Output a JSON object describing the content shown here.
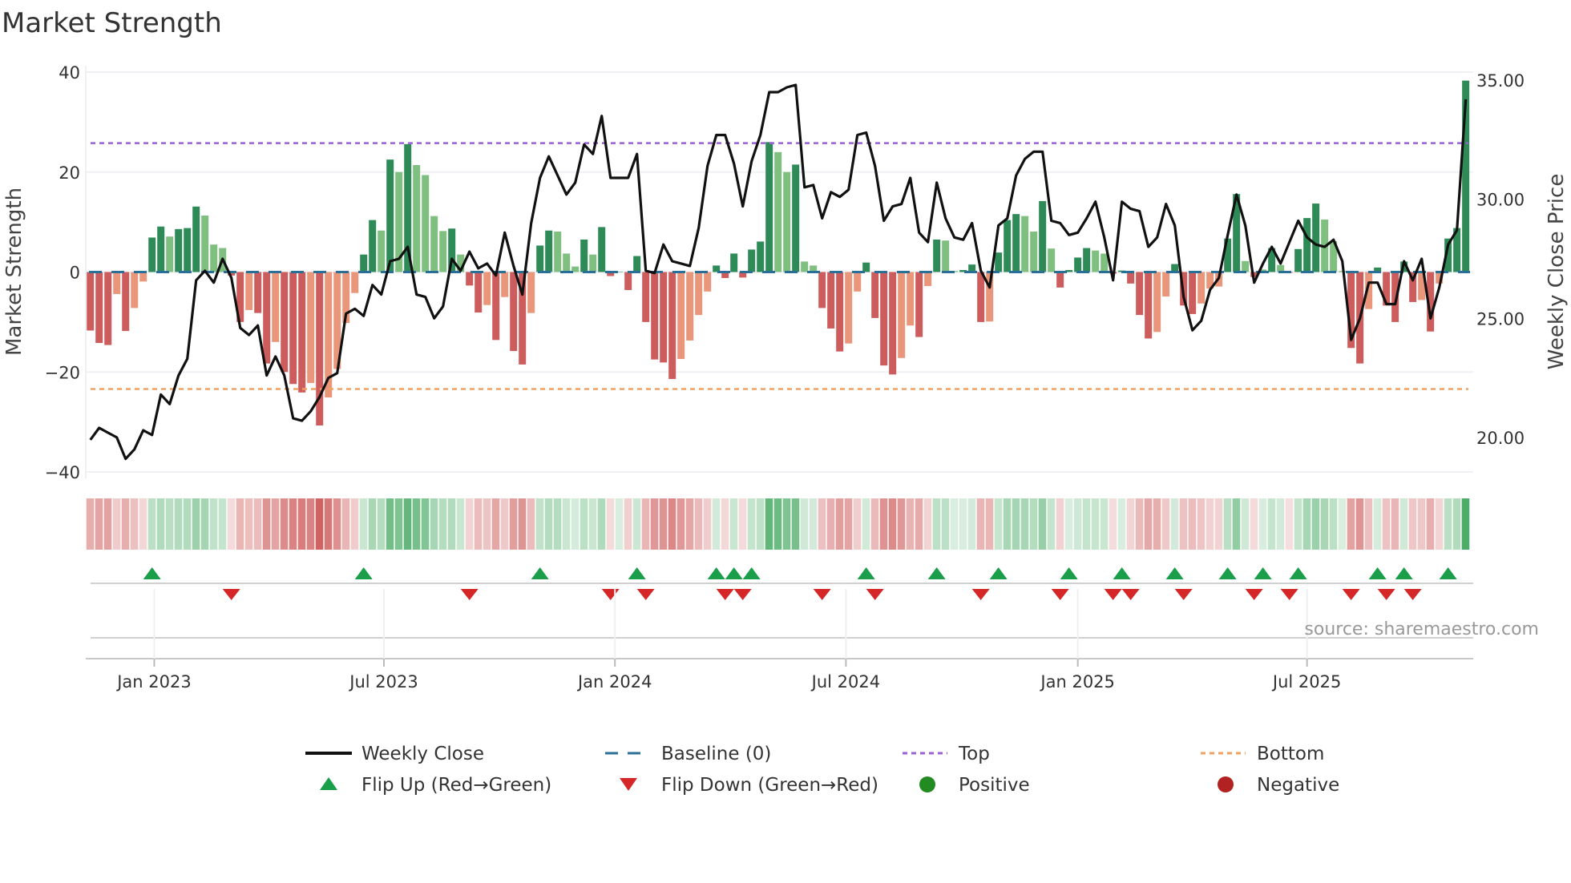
{
  "title": "Market Strength",
  "source": "source: sharemaestro.com",
  "chart_data": {
    "type": "bar+line",
    "title": "Market Strength",
    "ylabel_left": "Market Strength",
    "ylabel_right": "Weekly Close Price",
    "ylim_left": [
      -40,
      40
    ],
    "yticks_left": [
      {
        "value": 40,
        "label": "40"
      },
      {
        "value": 20,
        "label": "20"
      },
      {
        "value": 0,
        "label": "0"
      },
      {
        "value": -20,
        "label": "−20"
      },
      {
        "value": -40,
        "label": "−40"
      }
    ],
    "ylim_right": [
      18.55,
      35.34
    ],
    "yticks_right": [
      {
        "value": 35,
        "label": "35.00"
      },
      {
        "value": 30,
        "label": "30.00"
      },
      {
        "value": 25,
        "label": "25.00"
      },
      {
        "value": 20,
        "label": "20.00"
      }
    ],
    "xlim_week": [
      -0.52,
      156.85
    ],
    "x_ticks": [
      {
        "label": "Jan 2023",
        "week": 7.25
      },
      {
        "label": "Jul 2023",
        "week": 33.3
      },
      {
        "label": "Jan 2024",
        "week": 59.5
      },
      {
        "label": "Jul 2024",
        "week": 85.7
      },
      {
        "label": "Jan 2025",
        "week": 112.0
      },
      {
        "label": "Jul 2025",
        "week": 138.0
      }
    ],
    "top_level": 25.8,
    "bottom_level": -23.4,
    "grid": true,
    "strength": [
      -11.7,
      -14.2,
      -14.6,
      -4.4,
      -11.8,
      -7.2,
      -1.9,
      6.9,
      9.1,
      7.1,
      8.6,
      8.8,
      13.1,
      11.3,
      5.5,
      4.8,
      -0.7,
      -10,
      -7.6,
      -8.2,
      -18.3,
      -14,
      -20,
      -22.4,
      -24.1,
      -22.2,
      -30.7,
      -25.1,
      -19.4,
      -10.2,
      -4.2,
      3.5,
      10.4,
      8.3,
      22.5,
      20,
      25.6,
      21.4,
      19.4,
      11.2,
      8.2,
      8.7,
      3.5,
      -2.7,
      -8.1,
      -6.6,
      -13.6,
      -5,
      -15.8,
      -18.5,
      -8.2,
      5.3,
      8.3,
      8.1,
      3.7,
      1.1,
      6.5,
      3.5,
      9,
      -0.8,
      0,
      -3.6,
      3.2,
      -10,
      -17.5,
      -18.1,
      -21.4,
      -17.4,
      -13.7,
      -8.6,
      -3.9,
      1.3,
      -1.2,
      3.7,
      -1.1,
      4.5,
      6.1,
      26,
      24,
      20,
      21.5,
      2.1,
      1.3,
      -7.2,
      -11.3,
      -15.9,
      -14.3,
      -3.9,
      1.9,
      -9.2,
      -18.7,
      -20.5,
      -17.2,
      -10.7,
      -13,
      -2.8,
      6.5,
      6.3,
      0.2,
      0.4,
      1.5,
      -10,
      -9.9,
      3.9,
      10.4,
      11.6,
      11.2,
      8.1,
      14.2,
      4.7,
      -3.1,
      0.4,
      2.9,
      4.8,
      4.3,
      3.7,
      -0.3,
      0.3,
      -2.3,
      -8.6,
      -13.3,
      -12,
      -4.9,
      1.6,
      -6.7,
      -8.4,
      -6.3,
      -3.3,
      -2.9,
      6.7,
      15.6,
      2.2,
      -1,
      0.5,
      4.8,
      1.4,
      -0.2,
      4.6,
      10.8,
      13.7,
      10.5,
      6.2,
      0.2,
      -15.2,
      -18.3,
      -7.4,
      0.9,
      -6.7,
      -10,
      2.1,
      -6,
      -5.6,
      -11.9,
      -2.3,
      6.7,
      8.8,
      38.3
    ],
    "shade": [
      "d",
      "d",
      "d",
      "l",
      "d",
      "l",
      "l",
      "d",
      "d",
      "l",
      "d",
      "d",
      "d",
      "l",
      "l",
      "l",
      "d",
      "d",
      "l",
      "d",
      "d",
      "l",
      "d",
      "d",
      "d",
      "l",
      "d",
      "l",
      "l",
      "l",
      "l",
      "d",
      "d",
      "l",
      "d",
      "l",
      "d",
      "l",
      "l",
      "l",
      "l",
      "d",
      "l",
      "d",
      "d",
      "l",
      "d",
      "l",
      "d",
      "d",
      "l",
      "d",
      "d",
      "l",
      "l",
      "l",
      "d",
      "l",
      "d",
      "d",
      "d",
      "d",
      "d",
      "d",
      "d",
      "d",
      "d",
      "l",
      "l",
      "l",
      "l",
      "d",
      "d",
      "d",
      "d",
      "d",
      "d",
      "d",
      "l",
      "l",
      "d",
      "l",
      "l",
      "d",
      "d",
      "d",
      "l",
      "l",
      "d",
      "d",
      "d",
      "d",
      "l",
      "l",
      "d",
      "l",
      "d",
      "l",
      "l",
      "d",
      "d",
      "d",
      "l",
      "d",
      "d",
      "d",
      "l",
      "l",
      "d",
      "l",
      "d",
      "d",
      "d",
      "d",
      "l",
      "l",
      "d",
      "d",
      "d",
      "d",
      "d",
      "l",
      "l",
      "d",
      "d",
      "d",
      "l",
      "l",
      "l",
      "d",
      "d",
      "l",
      "d",
      "l",
      "d",
      "l",
      "l",
      "d",
      "d",
      "d",
      "l",
      "l",
      "l",
      "d",
      "d",
      "l",
      "d",
      "d",
      "d",
      "d",
      "d",
      "l",
      "d",
      "l",
      "d",
      "d",
      "d"
    ],
    "close": [
      19.9,
      20.4,
      20.2,
      20.0,
      19.1,
      19.5,
      20.3,
      20.1,
      21.8,
      21.4,
      22.6,
      23.3,
      26.6,
      27.0,
      26.5,
      27.5,
      26.7,
      24.6,
      24.3,
      24.7,
      22.6,
      23.4,
      22.6,
      20.8,
      20.7,
      21.1,
      21.7,
      22.5,
      22.7,
      25.2,
      25.4,
      25.1,
      26.4,
      26.0,
      27.4,
      27.5,
      28.0,
      26.0,
      25.9,
      25.0,
      25.5,
      27.5,
      27.0,
      27.8,
      27.1,
      27.3,
      26.8,
      28.6,
      27.2,
      26.0,
      29.0,
      30.9,
      31.8,
      31.0,
      30.2,
      30.7,
      32.3,
      31.9,
      33.5,
      30.9,
      30.9,
      30.9,
      31.9,
      27.0,
      26.9,
      28.1,
      27.4,
      27.3,
      27.2,
      28.8,
      31.4,
      32.7,
      32.7,
      31.5,
      29.7,
      31.6,
      32.7,
      34.5,
      34.5,
      34.7,
      34.8,
      30.5,
      30.6,
      29.2,
      30.3,
      30.1,
      30.4,
      32.7,
      32.8,
      31.4,
      29.1,
      29.7,
      29.8,
      30.9,
      28.6,
      28.2,
      30.7,
      29.2,
      28.4,
      28.3,
      29.0,
      27.0,
      26.3,
      28.9,
      29.2,
      31.0,
      31.7,
      32.0,
      32.0,
      29.1,
      29.0,
      28.5,
      28.6,
      29.2,
      29.9,
      28.4,
      26.6,
      29.9,
      29.6,
      29.5,
      28.0,
      28.4,
      29.8,
      28.9,
      25.9,
      24.5,
      24.9,
      26.2,
      26.7,
      28.5,
      30.2,
      28.9,
      26.5,
      27.3,
      28.0,
      27.3,
      28.2,
      29.1,
      28.4,
      28.1,
      28.0,
      28.3,
      27.4,
      24.1,
      25.0,
      26.5,
      26.5,
      25.6,
      25.6,
      27.4,
      26.6,
      27.5,
      25.0,
      26.3,
      28.1,
      28.7,
      34.2
    ],
    "flip_up": [
      7,
      31,
      51,
      62,
      71,
      73,
      75,
      88,
      96,
      103,
      111,
      117,
      123,
      129,
      133,
      137,
      146,
      149,
      154
    ],
    "flip_down": [
      16,
      43,
      59,
      63,
      72,
      74,
      83,
      89,
      101,
      110,
      116,
      118,
      124,
      132,
      136,
      143,
      147,
      150
    ],
    "legend": [
      {
        "label": "Weekly Close",
        "kind": "line"
      },
      {
        "label": "Baseline (0)",
        "kind": "dash"
      },
      {
        "label": "Top",
        "kind": "dot-top"
      },
      {
        "label": "Bottom",
        "kind": "dot-bottom"
      },
      {
        "label": "Flip Up (Red→Green)",
        "kind": "tri-up"
      },
      {
        "label": "Flip Down (Green→Red)",
        "kind": "tri-down"
      },
      {
        "label": "Positive",
        "kind": "dot-pos"
      },
      {
        "label": "Negative",
        "kind": "dot-neg"
      }
    ],
    "legend_placement": "bottom"
  },
  "colors": {
    "pos_strong": "#2e8b57",
    "pos_weak": "#7fbf7f",
    "neg_strong": "#cd5c5c",
    "neg_weak": "#e9967a",
    "close": "#111111",
    "baseline": "#2a6f97",
    "top": "#9b5fd6",
    "bottom": "#f0a060",
    "flip_up": "#1a9e4a",
    "flip_down": "#d62728",
    "positive": "#228b22",
    "negative": "#b22222",
    "grid": "#eef0f4"
  }
}
